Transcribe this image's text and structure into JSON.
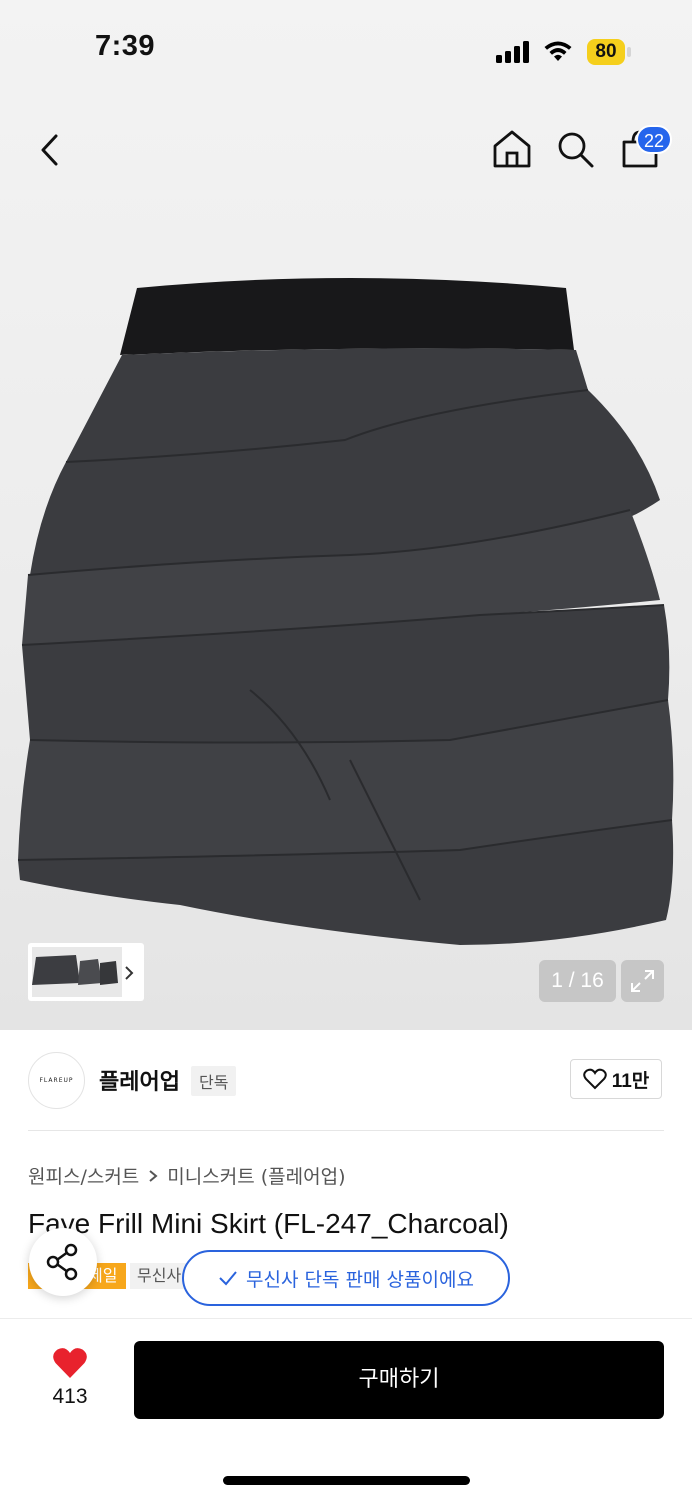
{
  "status_bar": {
    "time": "7:39",
    "battery": "80"
  },
  "header": {
    "cart_count": "22",
    "icons": [
      "back-icon",
      "home-icon",
      "search-icon",
      "cart-icon"
    ]
  },
  "gallery": {
    "page_indicator": "1 / 16"
  },
  "brand": {
    "logo_text": "FLAREUP",
    "name": "플레어업",
    "exclusive_tag": "단독",
    "likes": "11만"
  },
  "breadcrumb": {
    "category": "원피스/스커트",
    "subcategory": "미니스커트 (플레어업)"
  },
  "product": {
    "title": "Faye Frill Mini Skirt (FL-247_Charcoal)",
    "tag_sale": "세일",
    "tag_musinsa": "무신사"
  },
  "toast": {
    "text": "무신사 단독 판매 상품이에요"
  },
  "bottom_bar": {
    "wish_count": "413",
    "buy_label": "구매하기"
  },
  "colors": {
    "accent_blue": "#2a63dd",
    "badge_blue": "#2565ec",
    "sale_orange": "#f7a71b",
    "heart_red": "#e8222d"
  }
}
